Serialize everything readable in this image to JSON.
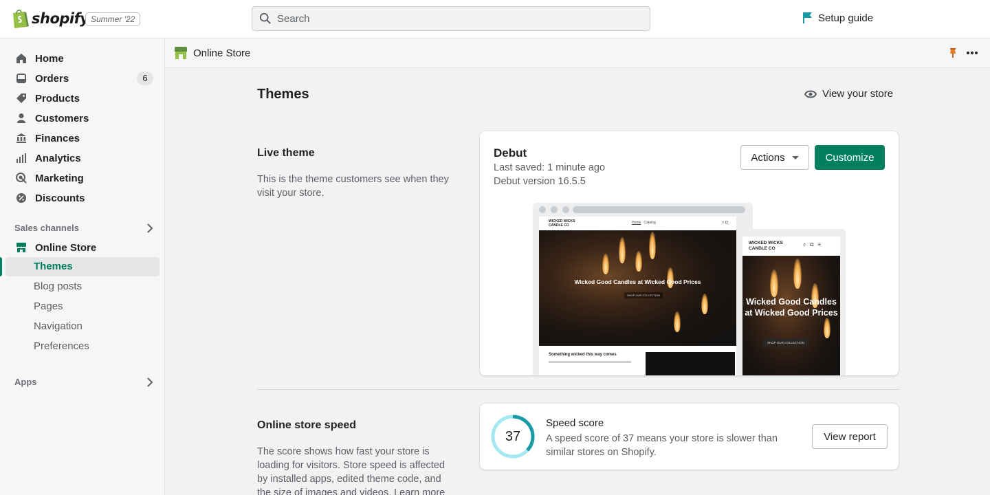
{
  "brand": {
    "name": "shopify",
    "edition": "Summer '22"
  },
  "search": {
    "placeholder": "Search"
  },
  "setup_guide": {
    "label": "Setup guide"
  },
  "sidebar": {
    "items": [
      {
        "label": "Home",
        "icon": "home-icon"
      },
      {
        "label": "Orders",
        "icon": "orders-icon",
        "badge": "6"
      },
      {
        "label": "Products",
        "icon": "tag-icon"
      },
      {
        "label": "Customers",
        "icon": "person-icon"
      },
      {
        "label": "Finances",
        "icon": "bank-icon"
      },
      {
        "label": "Analytics",
        "icon": "bar-chart-icon"
      },
      {
        "label": "Marketing",
        "icon": "target-icon"
      },
      {
        "label": "Discounts",
        "icon": "discount-icon"
      }
    ],
    "sales_channels": "Sales channels",
    "online_store": "Online Store",
    "sub_items": [
      "Themes",
      "Blog posts",
      "Pages",
      "Navigation",
      "Preferences"
    ],
    "apps": "Apps"
  },
  "appbar": {
    "title": "Online Store"
  },
  "page": {
    "title": "Themes",
    "view_store": "View your store"
  },
  "live_theme": {
    "title": "Live theme",
    "description": "This is the theme customers see when they visit your store.",
    "theme_name": "Debut",
    "last_saved": "Last saved: 1 minute ago",
    "version": "Debut version 16.5.5",
    "actions_label": "Actions",
    "customize_label": "Customize",
    "preview": {
      "brand": "WICKED WICKS CANDLE CO",
      "nav_home": "Home",
      "nav_catalog": "Catalog",
      "hero_text": "Wicked Good Candles at Wicked Good Prices",
      "hero_button": "SHOP OUR COLLECTION",
      "below_text": "Something wicked this way comes"
    }
  },
  "speed": {
    "title": "Online store speed",
    "description": "The score shows how fast your store is loading for visitors. Store speed is affected by installed apps, edited theme code, and the size of images and videos. Learn more",
    "score": 37,
    "score_label": "Speed score",
    "score_desc": "A speed score of 37 means your store is slower than similar stores on Shopify.",
    "report_label": "View report"
  },
  "colors": {
    "primary": "#008060",
    "accent_teal": "#1a9aa5",
    "badge": "#e4e5e7"
  }
}
